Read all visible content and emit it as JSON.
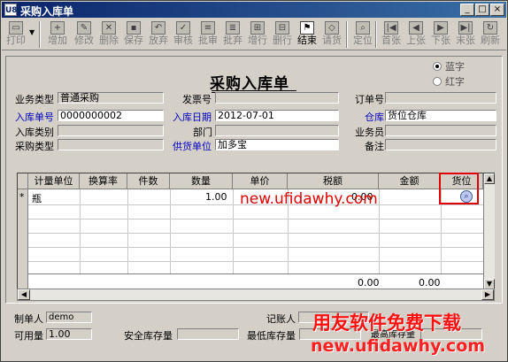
{
  "window": {
    "title": "采购入库单",
    "app_icon": "U8",
    "controls": [
      "_",
      "□",
      "×"
    ]
  },
  "toolbar": {
    "items": [
      {
        "label": "打印",
        "icon": "print-icon",
        "active": false
      },
      {
        "label": "增加",
        "icon": "add-icon",
        "active": false
      },
      {
        "label": "修改",
        "icon": "edit-icon",
        "active": false
      },
      {
        "label": "删除",
        "icon": "delete-icon",
        "active": false
      },
      {
        "label": "保存",
        "icon": "save-icon",
        "active": false
      },
      {
        "label": "放弃",
        "icon": "discard-icon",
        "active": false
      },
      {
        "label": "审核",
        "icon": "approve-icon",
        "active": false
      },
      {
        "label": "批审",
        "icon": "batch-approve-icon",
        "active": false
      },
      {
        "label": "批弃",
        "icon": "batch-discard-icon",
        "active": false
      },
      {
        "label": "增行",
        "icon": "add-row-icon",
        "active": false
      },
      {
        "label": "删行",
        "icon": "delete-row-icon",
        "active": false
      },
      {
        "label": "结束",
        "icon": "finish-icon",
        "active": true
      },
      {
        "label": "请货",
        "icon": "request-icon",
        "active": false
      },
      {
        "label": "定位",
        "icon": "locate-icon",
        "active": false
      },
      {
        "label": "首张",
        "icon": "first-icon",
        "active": false
      },
      {
        "label": "上张",
        "icon": "prev-icon",
        "active": false
      },
      {
        "label": "下张",
        "icon": "next-icon",
        "active": false
      },
      {
        "label": "末张",
        "icon": "last-icon",
        "active": false
      },
      {
        "label": "刷新",
        "icon": "refresh-icon",
        "active": false
      }
    ]
  },
  "form": {
    "title": "采购入库单",
    "radio_blue": "蓝字",
    "radio_red": "红字",
    "fields": {
      "business_type": {
        "label": "业务类型",
        "value": "普通采购"
      },
      "receipt_no": {
        "label": "入库单号",
        "value": "0000000002"
      },
      "receipt_category": {
        "label": "入库类别",
        "value": ""
      },
      "purchase_type": {
        "label": "采购类型",
        "value": ""
      },
      "delivery_no": {
        "label": "发票号",
        "value": ""
      },
      "receipt_date": {
        "label": "入库日期",
        "value": "2012-07-01"
      },
      "department": {
        "label": "部门",
        "value": ""
      },
      "supplier": {
        "label": "供货单位",
        "value": "加多宝"
      },
      "order_no": {
        "label": "订单号",
        "value": ""
      },
      "warehouse": {
        "label": "仓库",
        "value": "货位仓库"
      },
      "clerk": {
        "label": "业务员",
        "value": ""
      },
      "remark": {
        "label": "备注",
        "value": ""
      }
    }
  },
  "grid": {
    "columns": [
      "计量单位",
      "换算率",
      "件数",
      "数量",
      "单价",
      "税额",
      "金额",
      "货位"
    ],
    "rows": [
      {
        "marker": "*",
        "unit": "瓶",
        "rate": "",
        "pieces": "",
        "quantity": "1.00",
        "price": "",
        "tax": "0.00",
        "amount": "",
        "location": ""
      }
    ],
    "totals": {
      "tax": "0.00",
      "amount": "0.00"
    }
  },
  "footer": {
    "maker_label": "制单人",
    "maker_value": "demo",
    "bookkeeper_label": "记账人",
    "bookkeeper_value": "",
    "available_label": "可用量",
    "available_value": "1.00",
    "safety_stock_label": "安全库存量",
    "safety_stock_value": "",
    "min_stock_label": "最低库存量",
    "min_stock_value": "",
    "max_stock_label": "最高库存量",
    "max_stock_value": ""
  },
  "watermark": {
    "url_center": "new.ufidawhy.com",
    "brand": "用友软件免费下载",
    "url_bottom": "new.ufidawhy.com"
  },
  "colors": {
    "title_bar": "#0a246a",
    "blue_label": "#0000c0",
    "watermark": "#ff0000",
    "highlight": "#e00000"
  }
}
